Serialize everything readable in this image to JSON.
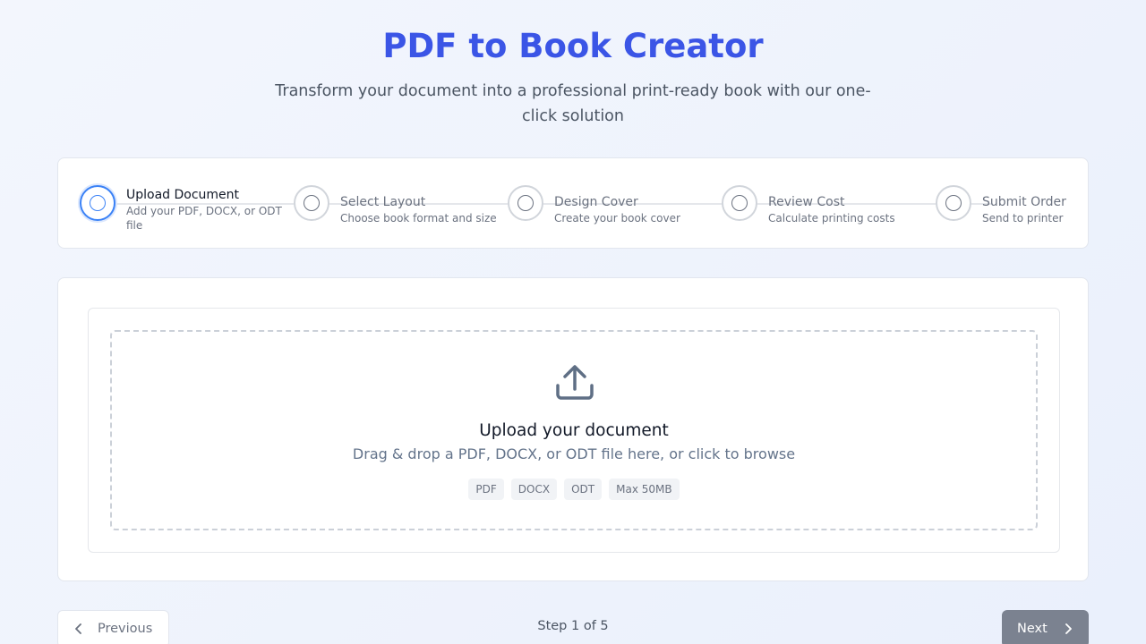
{
  "header": {
    "title": "PDF to Book Creator",
    "subtitle": "Transform your document into a professional print-ready book with our one-click solution"
  },
  "steps": [
    {
      "title": "Upload Document",
      "desc": "Add your PDF, DOCX, or ODT file",
      "active": true
    },
    {
      "title": "Select Layout",
      "desc": "Choose book format and size",
      "active": false
    },
    {
      "title": "Design Cover",
      "desc": "Create your book cover",
      "active": false
    },
    {
      "title": "Review Cost",
      "desc": "Calculate printing costs",
      "active": false
    },
    {
      "title": "Submit Order",
      "desc": "Send to printer",
      "active": false
    }
  ],
  "upload": {
    "icon": "upload-icon",
    "title": "Upload your document",
    "subtitle": "Drag & drop a PDF, DOCX, or ODT file here, or click to browse",
    "tags": [
      "PDF",
      "DOCX",
      "ODT",
      "Max 50MB"
    ]
  },
  "footer": {
    "prev_label": "Previous",
    "step_indicator": "Step 1 of 5",
    "next_label": "Next"
  },
  "colors": {
    "accent": "#3b55e6",
    "active_step": "#3b82f6",
    "next_button": "#7b8290"
  }
}
